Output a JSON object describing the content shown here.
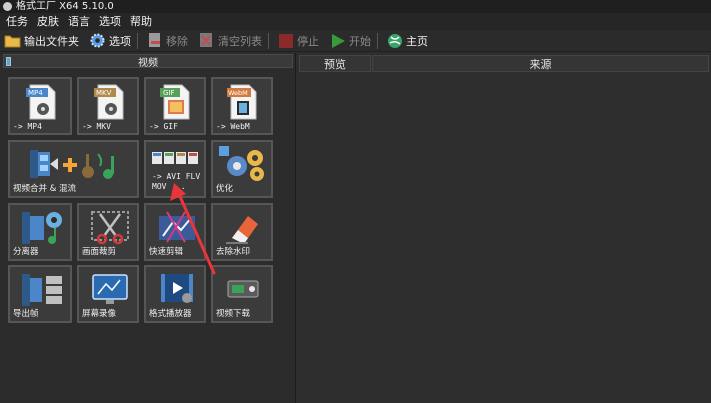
{
  "window": {
    "title": "格式工厂 X64 5.10.0"
  },
  "menu": [
    "任务",
    "皮肤",
    "语言",
    "选项",
    "帮助"
  ],
  "toolbar": {
    "output_folder": "输出文件夹",
    "options": "选项",
    "remove": "移除",
    "clear_list": "清空列表",
    "stop": "停止",
    "start": "开始",
    "home": "主页"
  },
  "left_panel": {
    "title": "视频"
  },
  "tiles": [
    {
      "label": "-> MP4",
      "badge": "MP4",
      "badge_color": "#4a86c8"
    },
    {
      "label": "-> MKV",
      "badge": "MKV",
      "badge_color": "#b08a4a"
    },
    {
      "label": "-> GIF",
      "badge": "GIF",
      "badge_color": "#5aa05a"
    },
    {
      "label": "-> WebM",
      "badge": "WebM",
      "badge_color": "#d07a40"
    },
    {
      "label": "视频合并 & 混流"
    },
    {
      "label": "-> AVI FLV MOV ..."
    },
    {
      "label": "优化"
    },
    {
      "label": "分离器"
    },
    {
      "label": "画面裁剪"
    },
    {
      "label": "快速剪辑"
    },
    {
      "label": "去除水印"
    },
    {
      "label": "导出帧"
    },
    {
      "label": "屏幕录像"
    },
    {
      "label": "格式播放器"
    },
    {
      "label": "视频下载"
    }
  ],
  "file_list": {
    "columns": [
      "预览",
      "来源"
    ]
  },
  "colors": {
    "annotation_arrow": "#e8353a",
    "accent": "#4a86c8"
  }
}
